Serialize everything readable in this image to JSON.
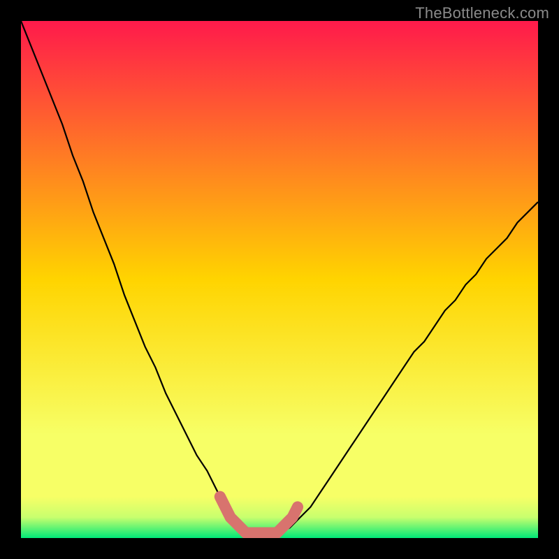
{
  "watermark": "TheBottleneck.com",
  "colors": {
    "bg_black": "#000000",
    "grad_top": "#ff1a4b",
    "grad_mid": "#ffd400",
    "grad_low": "#f7ff66",
    "grad_band": "#c8ff6e",
    "grad_bottom": "#00e878",
    "curve": "#000000",
    "highlight": "#d8736e"
  },
  "chart_data": {
    "type": "line",
    "title": "",
    "xlabel": "",
    "ylabel": "",
    "xlim": [
      0,
      100
    ],
    "ylim": [
      0,
      100
    ],
    "x": [
      0,
      2,
      4,
      6,
      8,
      10,
      12,
      14,
      16,
      18,
      20,
      22,
      24,
      26,
      28,
      30,
      32,
      34,
      36,
      38,
      40,
      41,
      42,
      43,
      44,
      45,
      46,
      47,
      48,
      49,
      50,
      52,
      54,
      56,
      58,
      60,
      62,
      64,
      66,
      68,
      70,
      72,
      74,
      76,
      78,
      80,
      82,
      84,
      86,
      88,
      90,
      92,
      94,
      96,
      98,
      100
    ],
    "values": [
      100,
      95,
      90,
      85,
      80,
      74,
      69,
      63,
      58,
      53,
      47,
      42,
      37,
      33,
      28,
      24,
      20,
      16,
      13,
      9,
      6,
      5,
      3,
      2,
      1,
      1,
      1,
      1,
      1,
      1,
      1,
      2,
      4,
      6,
      9,
      12,
      15,
      18,
      21,
      24,
      27,
      30,
      33,
      36,
      38,
      41,
      44,
      46,
      49,
      51,
      54,
      56,
      58,
      61,
      63,
      65
    ],
    "highlight": {
      "x": [
        38.5,
        39.5,
        40.5,
        41.5,
        42.5,
        43.5,
        44.5,
        45.5,
        46.5,
        47.5,
        48.5,
        49.5,
        50.5,
        51.5,
        52.5,
        53.5
      ],
      "y": [
        8,
        6,
        4,
        3,
        2,
        1,
        1,
        1,
        1,
        1,
        1,
        1,
        2,
        3,
        4,
        6
      ]
    }
  }
}
